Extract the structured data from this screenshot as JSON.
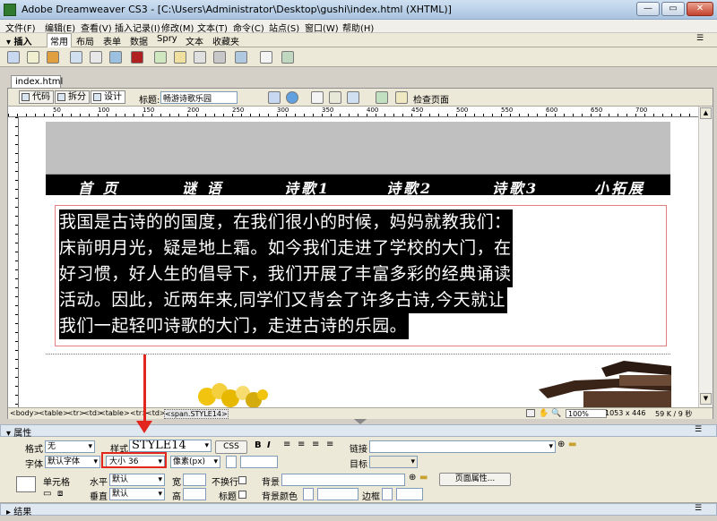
{
  "window": {
    "title": "Adobe Dreamweaver CS3 - [C:\\Users\\Administrator\\Desktop\\gushi\\index.html (XHTML)]"
  },
  "menu": [
    "文件(F)",
    "编辑(E)",
    "查看(V)",
    "插入记录(I)",
    "修改(M)",
    "文本(T)",
    "命令(C)",
    "站点(S)",
    "窗口(W)",
    "帮助(H)"
  ],
  "insert_bar": {
    "label": "▾ 插入",
    "tabs": [
      "常用",
      "布局",
      "表单",
      "数据",
      "Spry",
      "文本",
      "收藏夹"
    ],
    "active": "常用"
  },
  "document": {
    "tab": "index.html",
    "view_buttons": [
      "代码",
      "拆分",
      "设计"
    ],
    "title_label": "标题:",
    "title_value": "畅游诗歌乐园",
    "check_page": "检查页面"
  },
  "ruler_marks": [
    "50",
    "100",
    "150",
    "200",
    "250",
    "300",
    "350",
    "400",
    "450",
    "500",
    "550",
    "600",
    "650",
    "700"
  ],
  "page": {
    "nav_items": [
      "首 页",
      "谜 语",
      "诗歌1",
      "诗歌2",
      "诗歌3",
      "小拓展"
    ],
    "paragraph_lines": [
      "我国是古诗的的国度，在我们很小的时候，妈妈就教我们：",
      "床前明月光，疑是地上霜。如今我们走进了学校的大门，在",
      "好习惯，好人生的倡导下，我们开展了丰富多彩的经典诵读",
      "活动。因此，近两年来,同学们又背会了许多古诗,今天就让",
      "我们一起轻叩诗歌的大门，走进古诗的乐园。"
    ]
  },
  "status_bar": {
    "tags": [
      "<body>",
      "<table>",
      "<tr>",
      "<td>",
      "<table>",
      "<tr>",
      "<td>",
      "<span.STYLE14>"
    ],
    "zoom": "100%",
    "dimensions": "1053 x 446",
    "filesize": "59 K / 9 秒"
  },
  "properties": {
    "panel_title": "▾ 属性",
    "format_label": "格式",
    "format_value": "无",
    "style_label": "样式",
    "style_value": "STYLE14",
    "css_button": "CSS",
    "bold": "B",
    "italic": "I",
    "link_label": "链接",
    "font_label": "字体",
    "font_value": "默认字体",
    "size_label": "大小",
    "size_value": "36",
    "unit_value": "像素(px)",
    "target_label": "目标",
    "cell_label": "单元格",
    "horz_label": "水平",
    "horz_value": "默认",
    "vert_label": "垂直",
    "vert_value": "默认",
    "width_label": "宽",
    "height_label": "高",
    "nowrap_label": "不换行",
    "header_label": "标题",
    "bg_label": "背景",
    "bgcolor_label": "背景颜色",
    "border_label": "边框",
    "page_props_button": "页面属性..."
  },
  "results_panel": {
    "title": "▸ 结果"
  },
  "annotation_color": "#e3261d"
}
